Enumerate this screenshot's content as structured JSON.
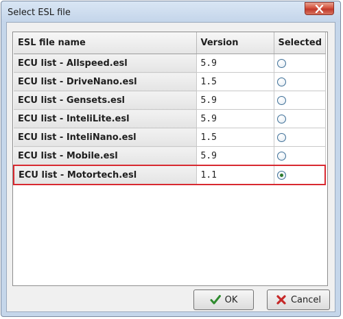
{
  "window": {
    "title": "Select ESL file"
  },
  "table": {
    "columns": [
      "ESL file name",
      "Version",
      "Selected"
    ],
    "rows": [
      {
        "name": "ECU list - Allspeed.esl",
        "version": "5.9",
        "selected": false
      },
      {
        "name": "ECU list - DriveNano.esl",
        "version": "1.5",
        "selected": false
      },
      {
        "name": "ECU list - Gensets.esl",
        "version": "5.9",
        "selected": false
      },
      {
        "name": "ECU list - InteliLite.esl",
        "version": "5.9",
        "selected": false
      },
      {
        "name": "ECU list - InteliNano.esl",
        "version": "1.5",
        "selected": false
      },
      {
        "name": "ECU list - Mobile.esl",
        "version": "5.9",
        "selected": false
      },
      {
        "name": "ECU list - Motortech.esl",
        "version": "1.1",
        "selected": true
      }
    ],
    "highlight_color": "#d8282f"
  },
  "buttons": {
    "ok_label": "OK",
    "cancel_label": "Cancel",
    "ok_icon": "checkmark-icon",
    "cancel_icon": "x-icon"
  },
  "colors": {
    "ok_icon": "#2e8b2e",
    "cancel_icon": "#c62828"
  }
}
